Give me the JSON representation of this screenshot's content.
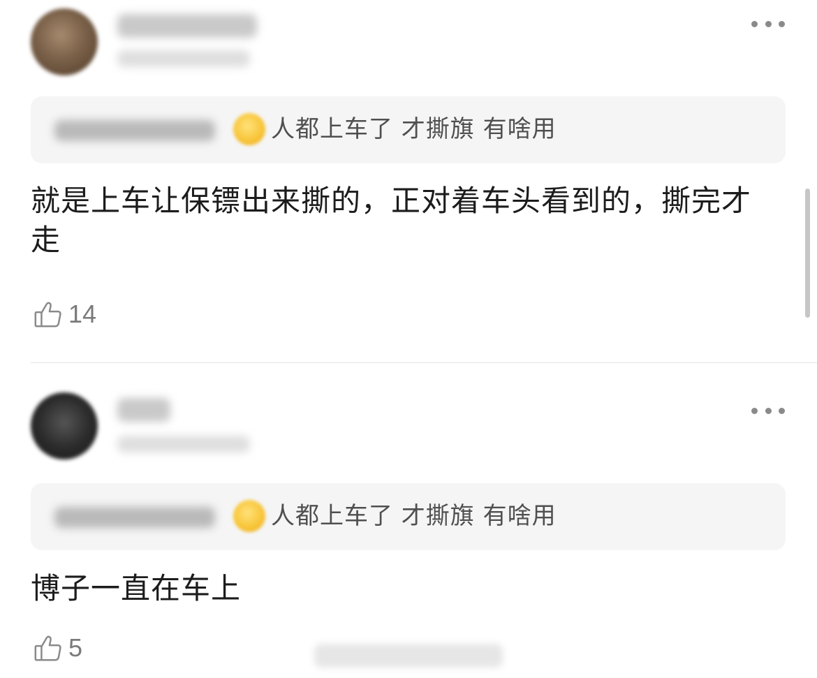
{
  "comments": [
    {
      "quote": {
        "emoji_icon": "tears-of-joy-emoji-icon",
        "text": "人都上车了 才撕旗 有啥用"
      },
      "body": "就是上车让保镖出来撕的，正对着车头看到的，撕完才走",
      "likes": "14"
    },
    {
      "quote": {
        "emoji_icon": "tears-of-joy-emoji-icon",
        "text": "人都上车了 才撕旗 有啥用"
      },
      "body": "博子一直在车上",
      "likes": "5"
    }
  ],
  "icons": {
    "more": "more-dots-icon",
    "like": "thumbs-up-icon"
  },
  "colors": {
    "quote_bg": "#f5f5f5",
    "quote_text": "#4f4f4f",
    "like_icon": "#8a8a8a",
    "divider": "#e3e3e3"
  }
}
